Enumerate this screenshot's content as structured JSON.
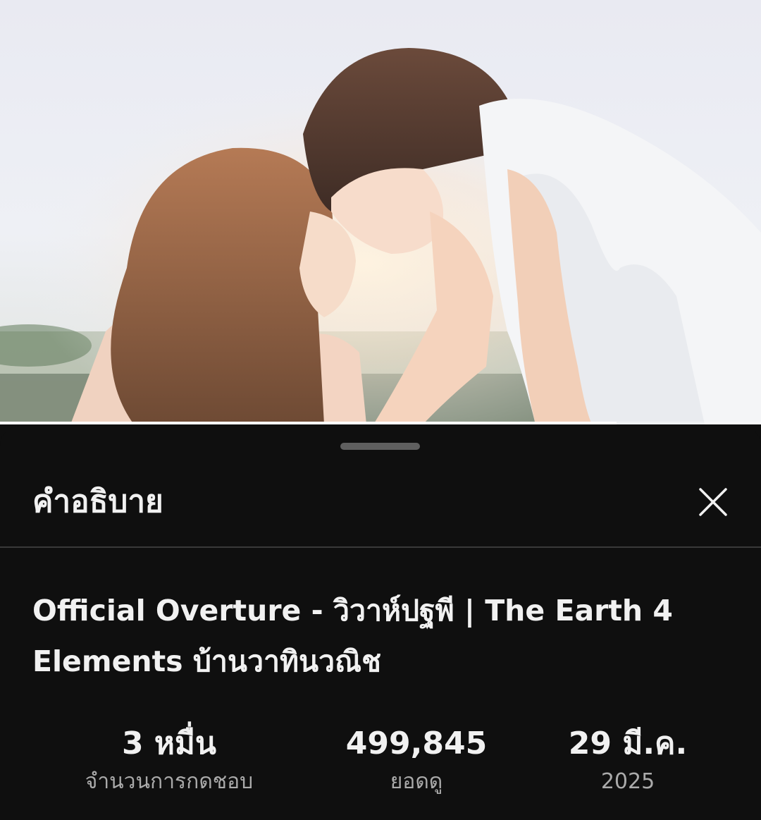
{
  "video": {
    "thumbnail_icon": "video-frame",
    "progress": 0.81,
    "progress_color": "#ffffff"
  },
  "sheet": {
    "title": "คำอธิบาย",
    "close_icon": "close-icon"
  },
  "details": {
    "title": "Official Overture - วิวาห์ปฐพี | The Earth 4 Elements บ้านวาทินวณิช"
  },
  "stats": [
    {
      "value": "3 หมื่น",
      "label": "จำนวนการกดชอบ"
    },
    {
      "value": "499,845",
      "label": "ยอดดู"
    },
    {
      "value": "29 มี.ค.",
      "label": "2025"
    }
  ],
  "colors": {
    "background": "#0f0f0f",
    "text_primary": "#f1f1f1",
    "text_secondary": "#aaaaaa"
  }
}
